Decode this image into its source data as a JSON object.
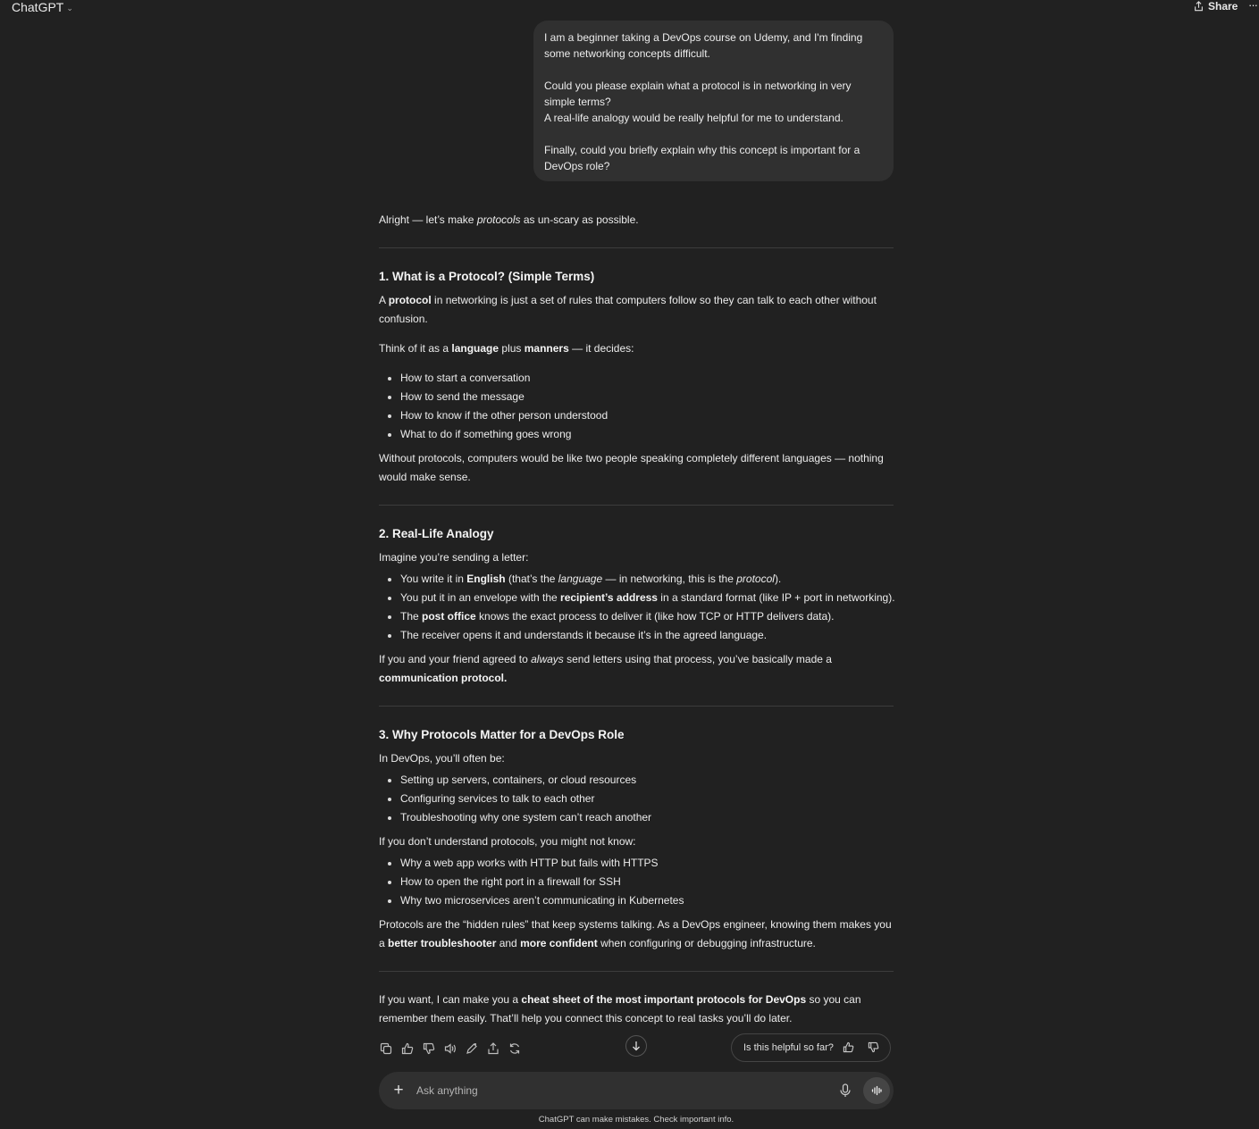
{
  "header": {
    "model_label": "ChatGPT",
    "share_label": "Share",
    "more_label": "···"
  },
  "user_message": {
    "p1": "I am a beginner taking a DevOps course on Udemy, and I'm finding some networking concepts difficult.",
    "p2a": "Could you please explain what a protocol is in networking in very simple terms?",
    "p2b": "A real-life analogy would be really helpful for me to understand.",
    "p3": "Finally, could you briefly explain why this concept is important for a DevOps role?"
  },
  "assistant": {
    "intro_a": "Alright — let’s make ",
    "intro_em": "protocols",
    "intro_b": " as un-scary as possible.",
    "s1": {
      "title": "1. What is a Protocol? (Simple Terms)",
      "p1_a": "A ",
      "p1_b": "protocol",
      "p1_c": " in networking is just a set of rules that computers follow so they can talk to each other without confusion.",
      "p2_a": "Think of it as a ",
      "p2_b": "language",
      "p2_c": " plus ",
      "p2_d": "manners",
      "p2_e": " — it decides:",
      "items": [
        "How to start a conversation",
        "How to send the message",
        "How to know if the other person understood",
        "What to do if something goes wrong"
      ],
      "p3": "Without protocols, computers would be like two people speaking completely different languages — nothing would make sense."
    },
    "s2": {
      "title": "2. Real-Life Analogy",
      "lead": "Imagine you’re sending a letter:",
      "li1_a": "You write it in ",
      "li1_b": "English",
      "li1_c": " (that’s the ",
      "li1_d": "language",
      "li1_e": " — in networking, this is the ",
      "li1_f": "protocol",
      "li1_g": ").",
      "li2_a": "You put it in an envelope with the ",
      "li2_b": "recipient’s address",
      "li2_c": " in a standard format (like IP + port in networking).",
      "li3_a": "The ",
      "li3_b": "post office",
      "li3_c": " knows the exact process to deliver it (like how TCP or HTTP delivers data).",
      "li4": "The receiver opens it and understands it because it’s in the agreed language.",
      "p_a": "If you and your friend agreed to ",
      "p_b": "always",
      "p_c": " send letters using that process, you’ve basically made a ",
      "p_d": "communication protocol",
      "p_e": "."
    },
    "s3": {
      "title": "3. Why Protocols Matter for a DevOps Role",
      "lead": "In DevOps, you’ll often be:",
      "items1": [
        "Setting up servers, containers, or cloud resources",
        "Configuring services to talk to each other",
        "Troubleshooting why one system can’t reach another"
      ],
      "lead2": "If you don’t understand protocols, you might not know:",
      "items2": [
        "Why a web app works with HTTP but fails with HTTPS",
        "How to open the right port in a firewall for SSH",
        "Why two microservices aren’t communicating in Kubernetes"
      ],
      "p_a": "Protocols are the “hidden rules” that keep systems talking. As a DevOps engineer, knowing them makes you a ",
      "p_b": "better troubleshooter",
      "p_c": " and ",
      "p_d": "more confident",
      "p_e": " when configuring or debugging infrastructure."
    },
    "outro_a": "If you want, I can make you a ",
    "outro_b": "cheat sheet of the most important protocols for DevOps",
    "outro_c": " so you can remember them easily. That’ll help you connect this concept to real tasks you’ll do later."
  },
  "feedback": {
    "question": "Is this helpful so far?"
  },
  "composer": {
    "placeholder": "Ask anything"
  },
  "disclaimer": "ChatGPT can make mistakes. Check important info."
}
